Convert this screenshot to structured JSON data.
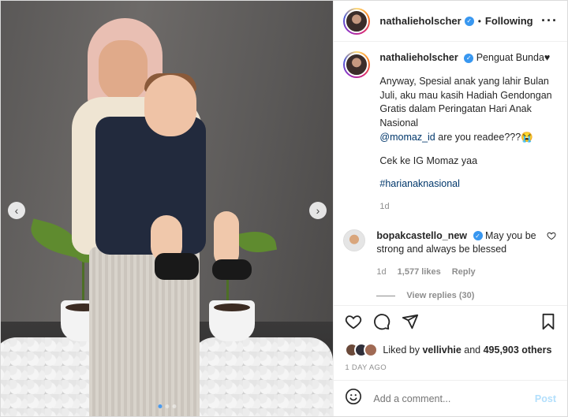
{
  "header": {
    "username": "nathalieholscher",
    "separator": "•",
    "follow_status": "Following",
    "more_icon": "more-horizontal-icon"
  },
  "caption": {
    "username": "nathalieholscher",
    "title_text": "Penguat Bunda♥",
    "paragraph1": "Anyway, Spesial anak yang lahir Bulan Juli, aku mau kasih Hadiah Gendongan Gratis dalam Peringatan Hari Anak Nasional",
    "mention": "@momaz_id",
    "mention_suffix": " are you readee???😭",
    "paragraph2": "Cek ke IG Momaz yaa",
    "hashtag": "#harianaknasional",
    "age": "1d"
  },
  "comments": [
    {
      "username": "bopakcastello_new",
      "text": "May you be strong and always be blessed",
      "age": "1d",
      "likes": "1,577 likes",
      "reply_label": "Reply",
      "view_replies": "View replies (30)"
    }
  ],
  "likes": {
    "prefix": "Liked by ",
    "user": "vellivhie",
    "middle": " and ",
    "count": "495,903 others"
  },
  "date": "1 DAY AGO",
  "add_comment": {
    "placeholder": "Add a comment...",
    "post_label": "Post"
  },
  "carousel": {
    "total": 3,
    "active": 1
  },
  "colors": {
    "verified": "#3897f0",
    "link": "#00376b",
    "post_disabled": "#b2dffc"
  }
}
